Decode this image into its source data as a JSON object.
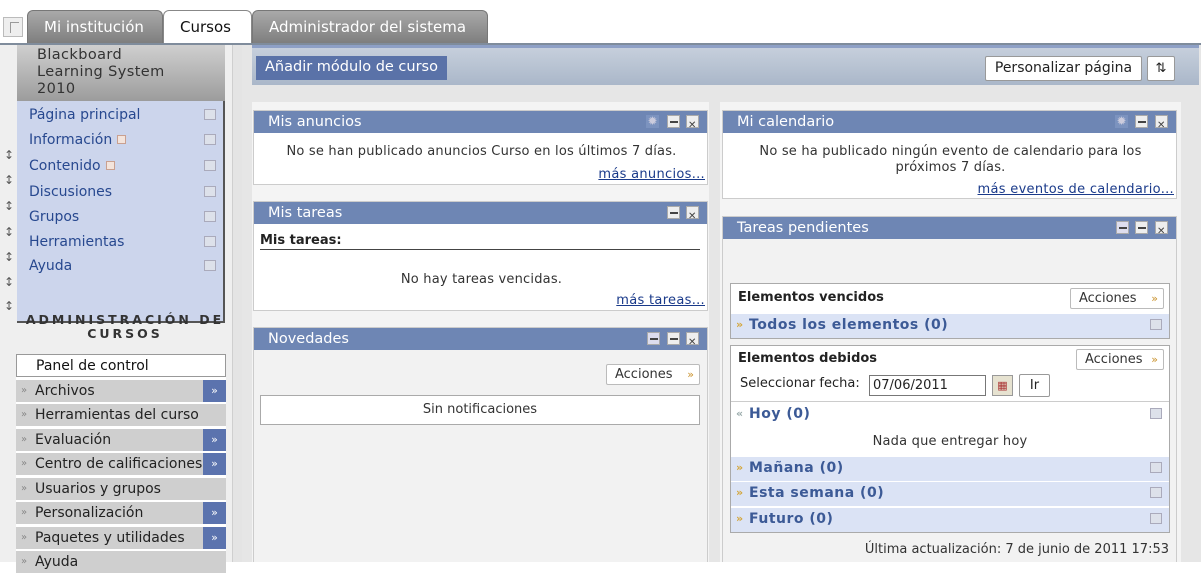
{
  "tabs": [
    "Mi institución",
    "Cursos",
    "Administrador del sistema"
  ],
  "brand": [
    "Blackboard",
    "Learning System",
    "2010"
  ],
  "course_menu": [
    {
      "label": "Página principal",
      "flag": false
    },
    {
      "label": "Información",
      "flag": true
    },
    {
      "label": "Contenido",
      "flag": true
    },
    {
      "label": "Discusiones",
      "flag": false
    },
    {
      "label": "Grupos",
      "flag": false
    },
    {
      "label": "Herramientas",
      "flag": false
    },
    {
      "label": "Ayuda",
      "flag": false
    }
  ],
  "admin": {
    "title": "ADMINISTRACIÓN DE CURSOS",
    "items": [
      {
        "label": "Panel de control",
        "go": false
      },
      {
        "label": "Archivos",
        "go": true
      },
      {
        "label": "Herramientas del curso",
        "go": false
      },
      {
        "label": "Evaluación",
        "go": true
      },
      {
        "label": "Centro de calificaciones",
        "go": true
      },
      {
        "label": "Usuarios y grupos",
        "go": false
      },
      {
        "label": "Personalización",
        "go": true
      },
      {
        "label": "Paquetes y utilidades",
        "go": true
      },
      {
        "label": "Ayuda",
        "go": false
      }
    ]
  },
  "main": {
    "add_module": "Añadir módulo de curso",
    "customize": "Personalizar página",
    "announcements": {
      "title": "Mis anuncios",
      "text": "No se han publicado anuncios Curso en los últimos 7 días.",
      "more": "más anuncios..."
    },
    "tasks": {
      "title": "Mis tareas",
      "label": "Mis tareas:",
      "text": "No hay tareas vencidas.",
      "more": "más tareas..."
    },
    "news": {
      "title": "Novedades",
      "actions": "Acciones",
      "text": "Sin notificaciones"
    },
    "calendar": {
      "title": "Mi calendario",
      "text1": "No se ha publicado ningún evento de calendario para los",
      "text2": "próximos 7 días.",
      "more": "más eventos de calendario..."
    },
    "pending": {
      "title": "Tareas pendientes",
      "overdue": "Elementos vencidos",
      "actions": "Acciones",
      "all_items": "Todos los elementos (0)",
      "due": "Elementos debidos",
      "date_label": "Seleccionar fecha:",
      "date_value": "07/06/2011",
      "go": "Ir",
      "today": "Hoy (0)",
      "today_empty": "Nada que entregar hoy",
      "tomorrow": "Mañana (0)",
      "week": "Esta semana (0)",
      "future": "Futuro (0)",
      "updated": "Última actualización: 7 de junio de 2011 17:53"
    }
  }
}
